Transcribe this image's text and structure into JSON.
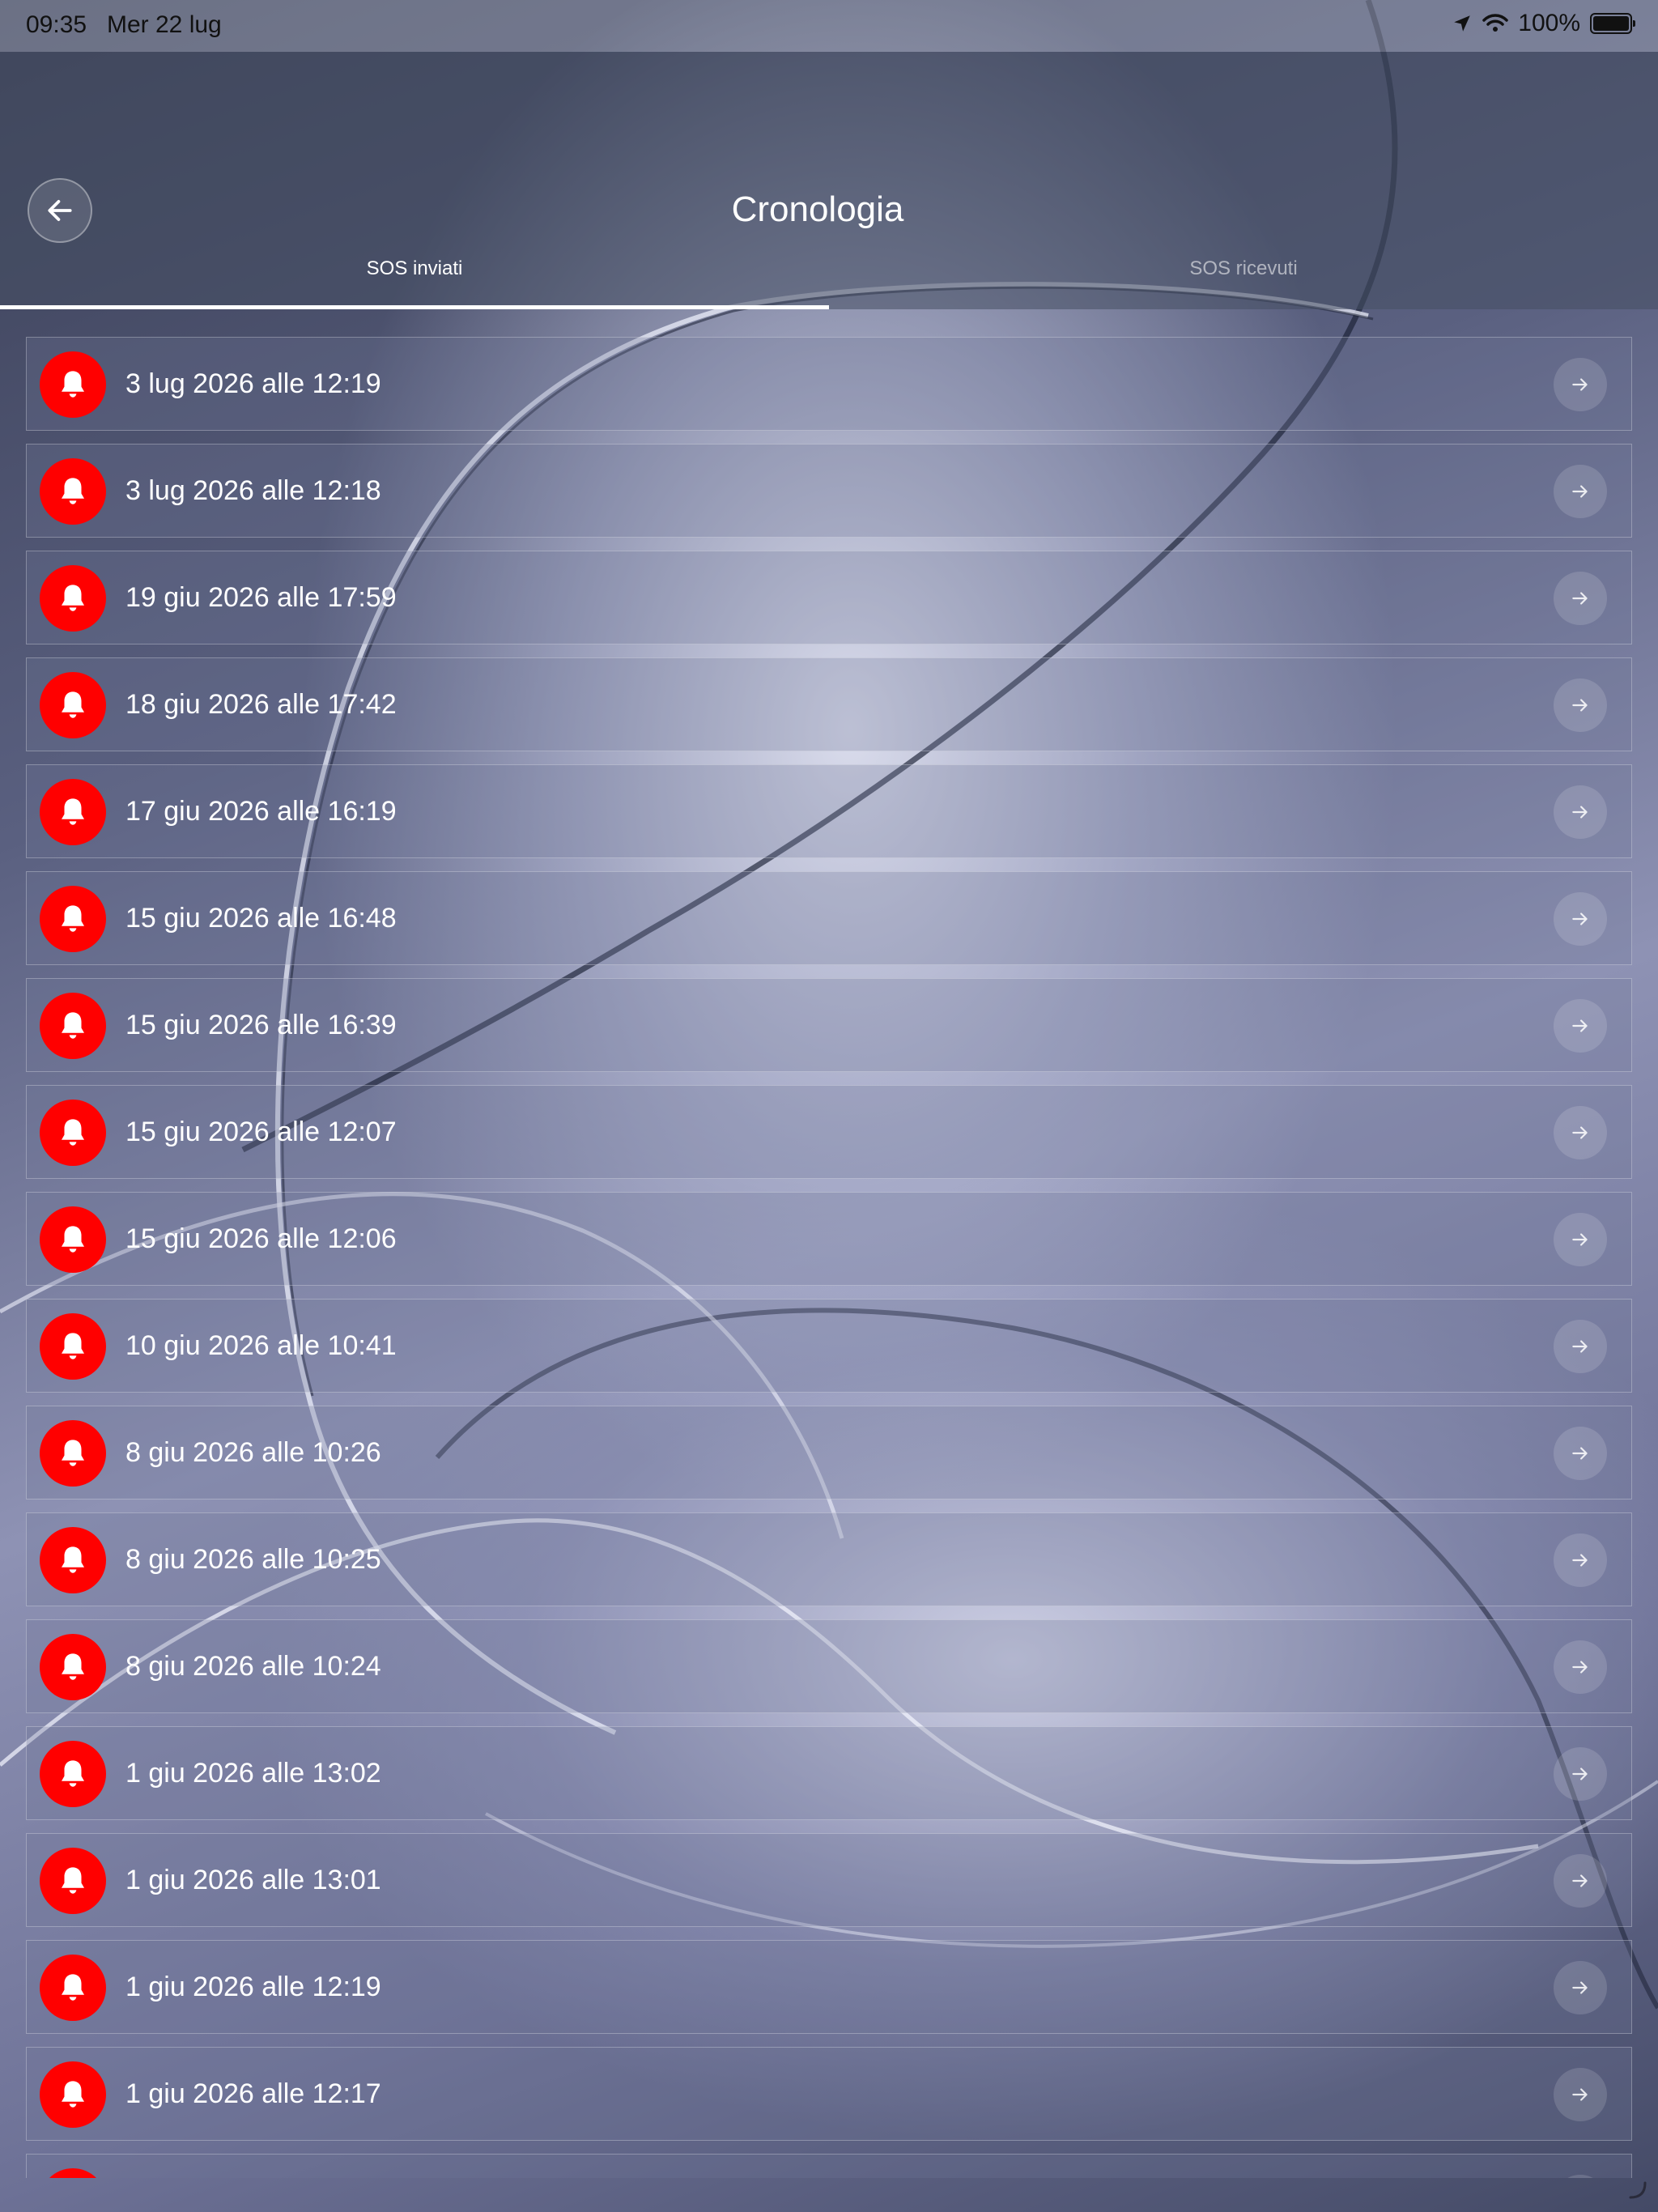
{
  "status_bar": {
    "time": "09:35",
    "date": "Mer 22 lug",
    "battery": "100%"
  },
  "header": {
    "title": "Cronologia"
  },
  "tabs": [
    {
      "label": "SOS inviati",
      "active": true
    },
    {
      "label": "SOS ricevuti",
      "active": false
    }
  ],
  "history": [
    {
      "label": "3 lug 2026 alle 12:19"
    },
    {
      "label": "3 lug 2026 alle 12:18"
    },
    {
      "label": "19 giu 2026 alle 17:59"
    },
    {
      "label": "18 giu 2026 alle 17:42"
    },
    {
      "label": "17 giu 2026 alle 16:19"
    },
    {
      "label": "15 giu 2026 alle 16:48"
    },
    {
      "label": "15 giu 2026 alle 16:39"
    },
    {
      "label": "15 giu 2026 alle 12:07"
    },
    {
      "label": "15 giu 2026 alle 12:06"
    },
    {
      "label": "10 giu 2026 alle 10:41"
    },
    {
      "label": "8 giu 2026 alle 10:26"
    },
    {
      "label": "8 giu 2026 alle 10:25"
    },
    {
      "label": "8 giu 2026 alle 10:24"
    },
    {
      "label": "1 giu 2026 alle 13:02"
    },
    {
      "label": "1 giu 2026 alle 13:01"
    },
    {
      "label": "1 giu 2026 alle 12:19"
    },
    {
      "label": "1 giu 2026 alle 12:17"
    },
    {
      "label": ""
    }
  ],
  "icons": {
    "alarm": "bell-icon",
    "open": "arrow-right-icon",
    "back": "arrow-left-icon"
  },
  "colors": {
    "alarm_bg": "#ff0000",
    "header_bg": "#464e62"
  }
}
